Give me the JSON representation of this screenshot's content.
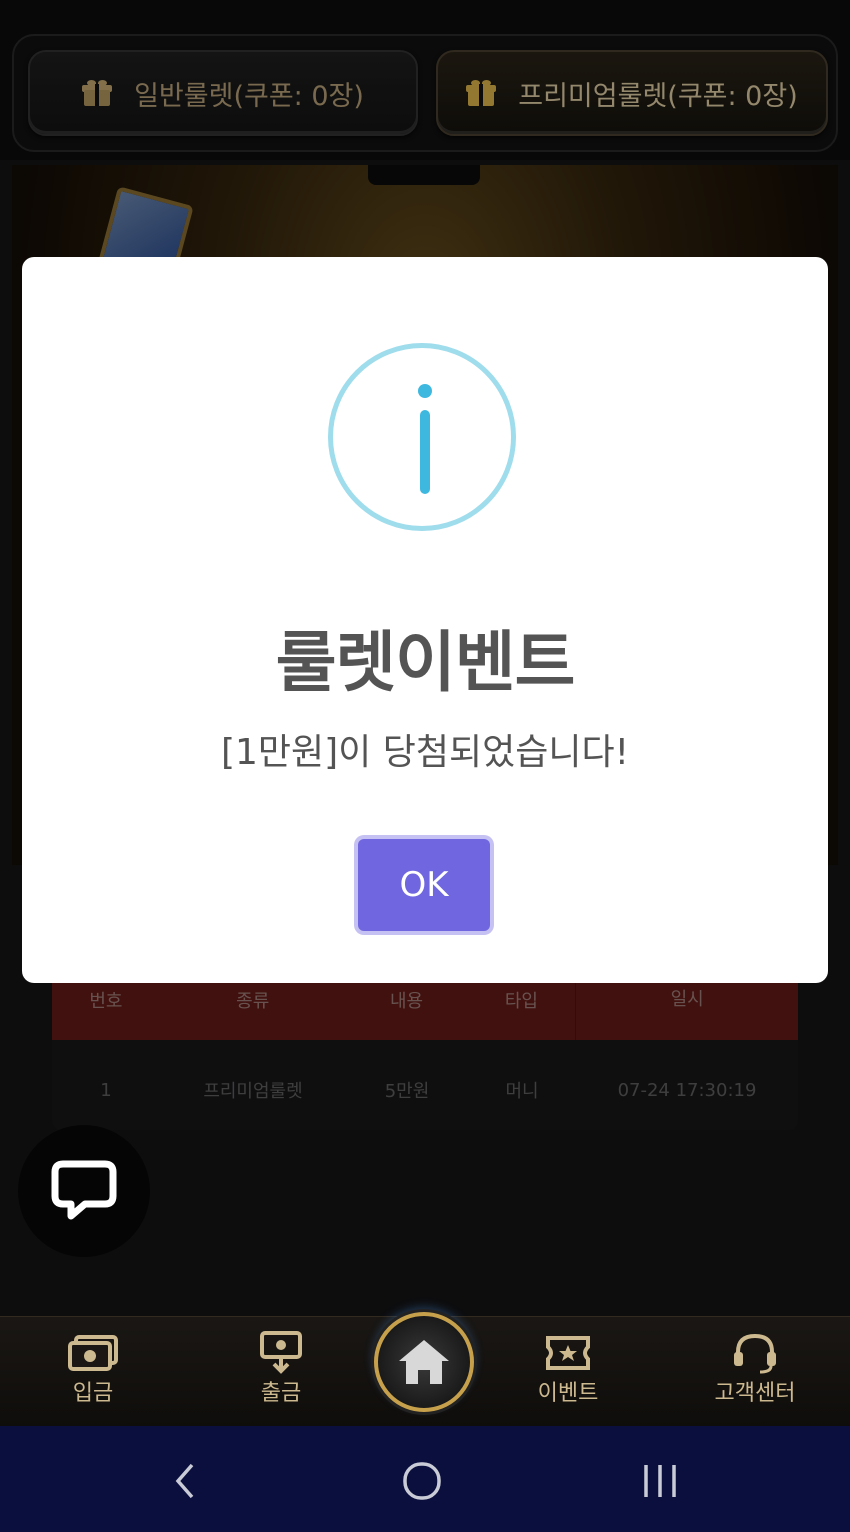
{
  "tabs": {
    "normal_label": "일반룰렛(쿠폰: 0장)",
    "premium_label": "프리미엄룰렛(쿠폰: 0장)"
  },
  "history": {
    "headers": [
      "번호",
      "종류",
      "내용",
      "타입",
      "일시"
    ],
    "rows": [
      [
        "1",
        "프리미엄룰렛",
        "5만원",
        "머니",
        "07-24 17:30:19"
      ]
    ]
  },
  "modal": {
    "title": "룰렛이벤트",
    "message": "[1만원]이 당첨되었습니다!",
    "ok_label": "OK"
  },
  "bottom_nav": {
    "deposit": "입금",
    "withdraw": "출금",
    "event": "이벤트",
    "support": "고객센터"
  },
  "colors": {
    "accent": "#7066e0",
    "info": "#3fb8e0",
    "table_header": "#8f2720",
    "gold": "#c7a04c"
  },
  "icons": [
    "gift-icon",
    "info-icon",
    "chat-icon",
    "deposit-icon",
    "withdraw-icon",
    "home-icon",
    "event-ticket-icon",
    "headset-icon",
    "back-icon",
    "home-circle-icon",
    "recents-icon"
  ]
}
